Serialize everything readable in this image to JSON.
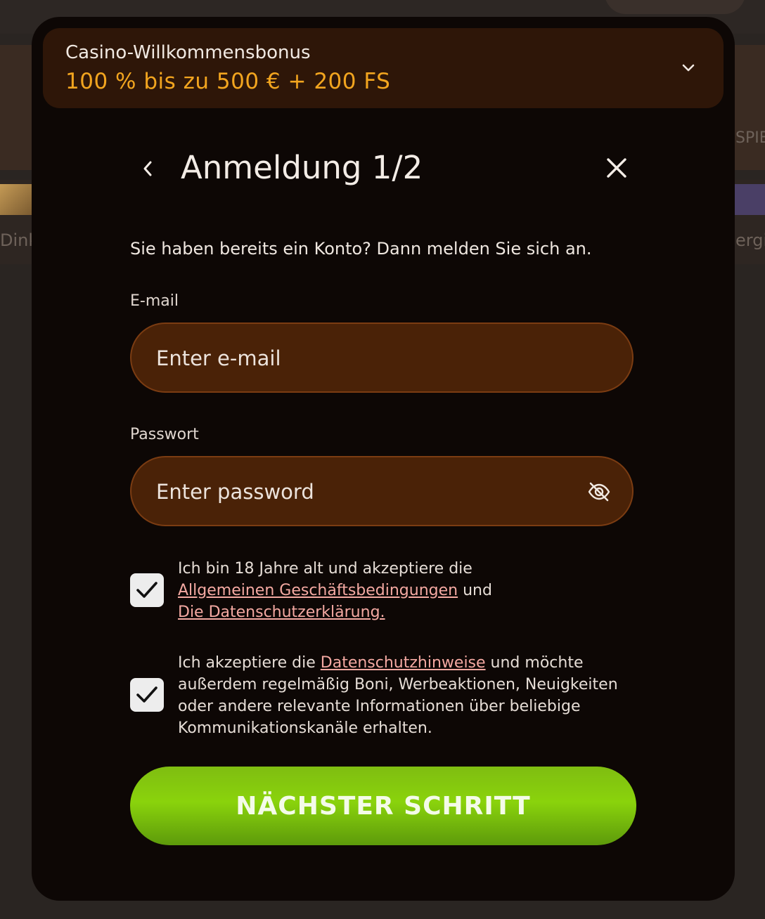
{
  "background": {
    "left_fragment": "Dink",
    "right_top_fragment": "SPIE",
    "right_fragment": "ergi"
  },
  "bonus": {
    "title": "Casino-Willkommensbonus",
    "value": "100 % bis zu 500 € + 200 FS",
    "chevron_icon": "chevron-down-icon"
  },
  "header": {
    "title": "Anmeldung 1/2",
    "back_icon": "chevron-left-icon",
    "close_icon": "close-icon"
  },
  "subtitle": "Sie haben bereits ein Konto? Dann melden Sie sich an.",
  "email": {
    "label": "E-mail",
    "placeholder": "Enter e-mail"
  },
  "password": {
    "label": "Passwort",
    "placeholder": "Enter password",
    "toggle_icon": "eye-off-icon"
  },
  "consent1": {
    "checked": true,
    "text_before": "Ich bin 18 Jahre alt und akzeptiere die",
    "link1": "Allgemeinen Geschäftsbedingungen",
    "text_middle": "und",
    "link2": "Die Datenschutzerklärung."
  },
  "consent2": {
    "checked": true,
    "text_before": "Ich akzeptiere die",
    "link": "Datenschutzhinweise",
    "text_after": "und möchte außerdem regelmäßig Boni, Werbeaktionen, Neuigkeiten oder andere relevante Informationen über beliebige Kommunikationskanäle erhalten."
  },
  "next_button": "NÄCHSTER SCHRITT",
  "colors": {
    "accent_orange": "#f2a51f",
    "field_bg": "#4a2207",
    "button_green": "#7fbd11",
    "link_pink": "#f4a9a2"
  }
}
